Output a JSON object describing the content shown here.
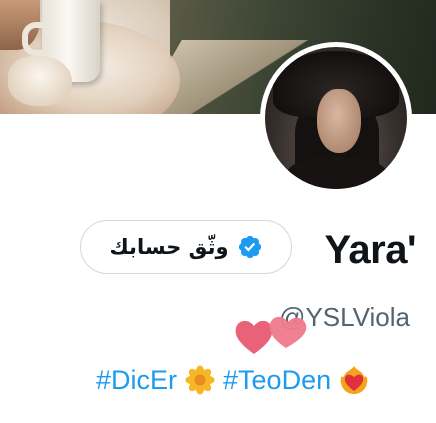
{
  "profile": {
    "display_name": "Yara'",
    "verify_button_label": "وثّق حسابك",
    "handle": "@YSLViola",
    "bio": {
      "hashtag_1": "#DicEr",
      "emoji_1": "flower-emoji",
      "hashtag_2": "#TeoDen",
      "emoji_2": "heart-on-fire-emoji"
    }
  },
  "icons": {
    "verified": "verified-badge-icon",
    "hearts": "two-hearts-emoji"
  },
  "colors": {
    "link": "#1d9bf0",
    "verified_badge": "#1d9bf0",
    "handle_text": "#536471",
    "name_text": "#0f1419",
    "hearts": "#e8556d"
  }
}
